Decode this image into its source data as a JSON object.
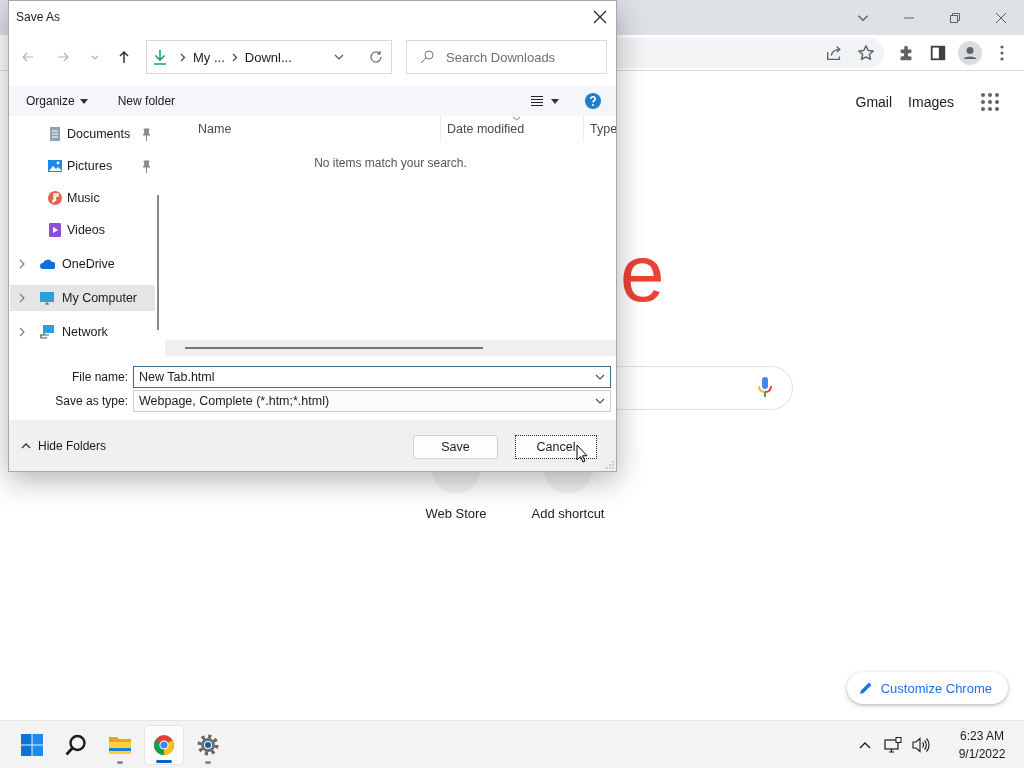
{
  "browser": {
    "header_links": [
      "Gmail",
      "Images"
    ],
    "logo_visible_text": "e",
    "shortcuts": [
      {
        "label": "Web Store"
      },
      {
        "label": "Add shortcut"
      }
    ],
    "customize_button": "Customize Chrome"
  },
  "dialog": {
    "title": "Save As",
    "nav_buttons": [
      {
        "kind": "back",
        "disabled": true
      },
      {
        "kind": "forward",
        "disabled": true
      },
      {
        "kind": "recent",
        "disabled": true
      },
      {
        "kind": "up",
        "disabled": false
      }
    ],
    "address_segments": [
      "My ...",
      "Downl..."
    ],
    "search": {
      "placeholder": "Search Downloads"
    },
    "toolbar": {
      "organize": "Organize",
      "new_folder": "New folder"
    },
    "nav_pane": [
      {
        "label": "Documents",
        "kind": "documents",
        "pinned": true,
        "expandable": false,
        "selected": false
      },
      {
        "label": "Pictures",
        "kind": "pictures",
        "pinned": true,
        "expandable": false,
        "selected": false
      },
      {
        "label": "Music",
        "kind": "music",
        "pinned": false,
        "expandable": false,
        "selected": false
      },
      {
        "label": "Videos",
        "kind": "videos",
        "pinned": false,
        "expandable": false,
        "selected": false
      },
      {
        "label": "OneDrive",
        "kind": "onedrive",
        "pinned": false,
        "expandable": true,
        "selected": false
      },
      {
        "label": "My Computer",
        "kind": "computer",
        "pinned": false,
        "expandable": true,
        "selected": true
      },
      {
        "label": "Network",
        "kind": "network",
        "pinned": false,
        "expandable": true,
        "selected": false
      }
    ],
    "columns": [
      {
        "label": "Name",
        "sorted": false
      },
      {
        "label": "Date modified",
        "sorted": true
      },
      {
        "label": "Type",
        "sorted": false
      }
    ],
    "empty_message": "No items match your search.",
    "fields": [
      {
        "label": "File name:",
        "value": "New Tab.html",
        "focused": true
      },
      {
        "label": "Save as type:",
        "value": "Webpage, Complete (*.htm;*.html)",
        "focused": false
      }
    ],
    "hide_folders": "Hide Folders",
    "buttons": [
      {
        "label": "Save",
        "focused": false
      },
      {
        "label": "Cancel",
        "focused": true
      }
    ]
  },
  "taskbar": {
    "apps": [
      {
        "kind": "start",
        "running": false,
        "active": false
      },
      {
        "kind": "search",
        "running": false,
        "active": false
      },
      {
        "kind": "explorer",
        "running": true,
        "active": false
      },
      {
        "kind": "chrome",
        "running": true,
        "active": true
      },
      {
        "kind": "settings",
        "running": true,
        "active": false
      }
    ],
    "time": "6:23 AM",
    "date": "9/1/2022"
  }
}
